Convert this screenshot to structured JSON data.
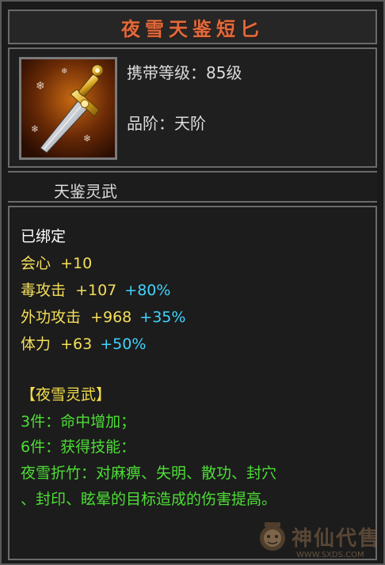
{
  "item": {
    "name": "夜雪天鉴短匕",
    "level_line": "携带等级：85级",
    "grade_line": "品阶：天阶",
    "icon": "dagger-icon"
  },
  "set_title": "天鉴灵武",
  "bound_status": "已绑定",
  "attributes": [
    {
      "name": "会心",
      "value": "+10",
      "percent": ""
    },
    {
      "name": "毒攻击",
      "value": "+107",
      "percent": "+80%"
    },
    {
      "name": "外功攻击",
      "value": "+968",
      "percent": "+35%"
    },
    {
      "name": "体力",
      "value": "+63",
      "percent": "+50%"
    }
  ],
  "set_bonus": {
    "header": "【夜雪灵武】",
    "piece3": "3件：命中增加；",
    "piece6": "6件：获得技能：",
    "skill_line1": "夜雪折竹：对麻痹、失明、散功、封穴",
    "skill_line2": "、封印、眩晕的目标造成的伤害提高。"
  },
  "watermark": {
    "text": "神仙代售",
    "url": "WWW.SXDS.COM"
  },
  "colors": {
    "title": "#e06a3c",
    "value_gold": "#f5df5a",
    "percent_cyan": "#3fd4ff",
    "set_green": "#4dde36",
    "set_header_yellow": "#f5e04a"
  }
}
